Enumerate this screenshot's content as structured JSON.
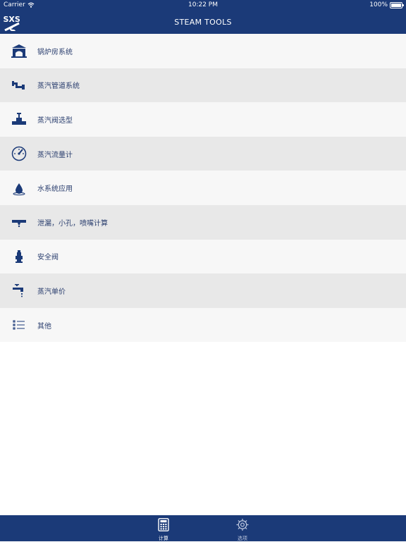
{
  "status_bar": {
    "carrier": "Carrier",
    "time": "10:22 PM",
    "battery": "100%",
    "battery_level": 1.0
  },
  "header": {
    "logo_text": "SXS",
    "title": "STEAM TOOLS"
  },
  "menu": [
    {
      "icon": "boiler-house-icon",
      "label": "锅炉房系统"
    },
    {
      "icon": "steam-pipe-icon",
      "label": "蒸汽管道系统"
    },
    {
      "icon": "valve-icon",
      "label": "蒸汽阀选型"
    },
    {
      "icon": "flow-meter-gauge-icon",
      "label": "蒸汽流量计"
    },
    {
      "icon": "water-drop-icon",
      "label": "水系统应用"
    },
    {
      "icon": "leak-nozzle-icon",
      "label": "泄漏，小孔，喷嘴计算"
    },
    {
      "icon": "safety-valve-icon",
      "label": "安全阀"
    },
    {
      "icon": "steam-tap-icon",
      "label": "蒸汽单价"
    },
    {
      "icon": "list-icon",
      "label": "其他"
    }
  ],
  "tabs": [
    {
      "icon": "calculator-icon",
      "label": "计算",
      "active": true
    },
    {
      "icon": "gear-icon",
      "label": "选项",
      "active": false
    }
  ],
  "colors": {
    "primary": "#1b3a78",
    "row_light": "#f7f7f7",
    "row_dark": "#e8e8e8",
    "label": "#2a3e6e"
  }
}
